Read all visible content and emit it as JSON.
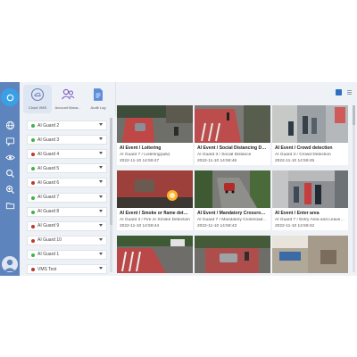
{
  "top_menu": {
    "items": [
      {
        "label": "Cloud VMS",
        "icon": "cloud-vms-icon"
      },
      {
        "label": "Account Mana...",
        "icon": "account-management-icon"
      },
      {
        "label": "Audit Log",
        "icon": "audit-log-icon"
      }
    ]
  },
  "rail": {
    "icons": [
      "home-icon",
      "globe-icon",
      "chat-icon",
      "eye-icon",
      "search-icon",
      "zoom-icon",
      "folder-icon",
      "user-avatar-icon"
    ]
  },
  "guards": [
    {
      "label": "AI Guard 2",
      "status_color": "#3cb34a"
    },
    {
      "label": "AI Guard 3",
      "status_color": "#3cb34a"
    },
    {
      "label": "AI Guard 4",
      "status_color": "#c0392b"
    },
    {
      "label": "AI Guard 5",
      "status_color": "#3cb34a"
    },
    {
      "label": "AI Guard 6",
      "status_color": "#c0392b"
    },
    {
      "label": "AI Guard 7",
      "status_color": "#3cb34a"
    },
    {
      "label": "AI Guard 8",
      "status_color": "#3cb34a"
    },
    {
      "label": "AI Guard 9",
      "status_color": "#c0392b"
    },
    {
      "label": "AI Guard 10",
      "status_color": "#c0392b"
    },
    {
      "label": "AI Guard 1",
      "status_color": "#3cb34a"
    },
    {
      "label": "VMS Test",
      "status_color": "#c0392b"
    }
  ],
  "events": [
    {
      "title": "AI Event / Loitering",
      "subtitle": "AI Guard 7 / Loitering(adv)",
      "time": "2022-11-10 14:59:47"
    },
    {
      "title": "AI Event / Social Distancing Detection",
      "subtitle": "AI Guard 3 / Social Distance",
      "time": "2022-11-10 14:59:46"
    },
    {
      "title": "AI Event / Crowd detection",
      "subtitle": "AI Guard 3 / Crowd Detection",
      "time": "2022-11-10 14:59:45"
    },
    {
      "title": "AI Event / Smoke or flame detection",
      "subtitle": "AI Guard 3 / Fire or Smoke Detection",
      "time": "2022-11-10 14:59:44"
    },
    {
      "title": "AI Event / Mandatory Crossroad St...",
      "subtitle": "AI Guard 7 / Mandatory Crossroad St...",
      "time": "2022-11-10 14:59:43"
    },
    {
      "title": "AI Event / Enter area",
      "subtitle": "AI Guard 7 / Entry Area and Leave Ar...",
      "time": "2022-11-10 14:59:42"
    },
    {
      "title": "",
      "subtitle": "",
      "time": ""
    },
    {
      "title": "",
      "subtitle": "",
      "time": ""
    },
    {
      "title": "",
      "subtitle": "",
      "time": ""
    }
  ],
  "colors": {
    "rail": "#5e84bd",
    "accent": "#2f6fbd",
    "online": "#3cb34a",
    "offline": "#c0392b",
    "detection_zone": "#e03a3a"
  }
}
